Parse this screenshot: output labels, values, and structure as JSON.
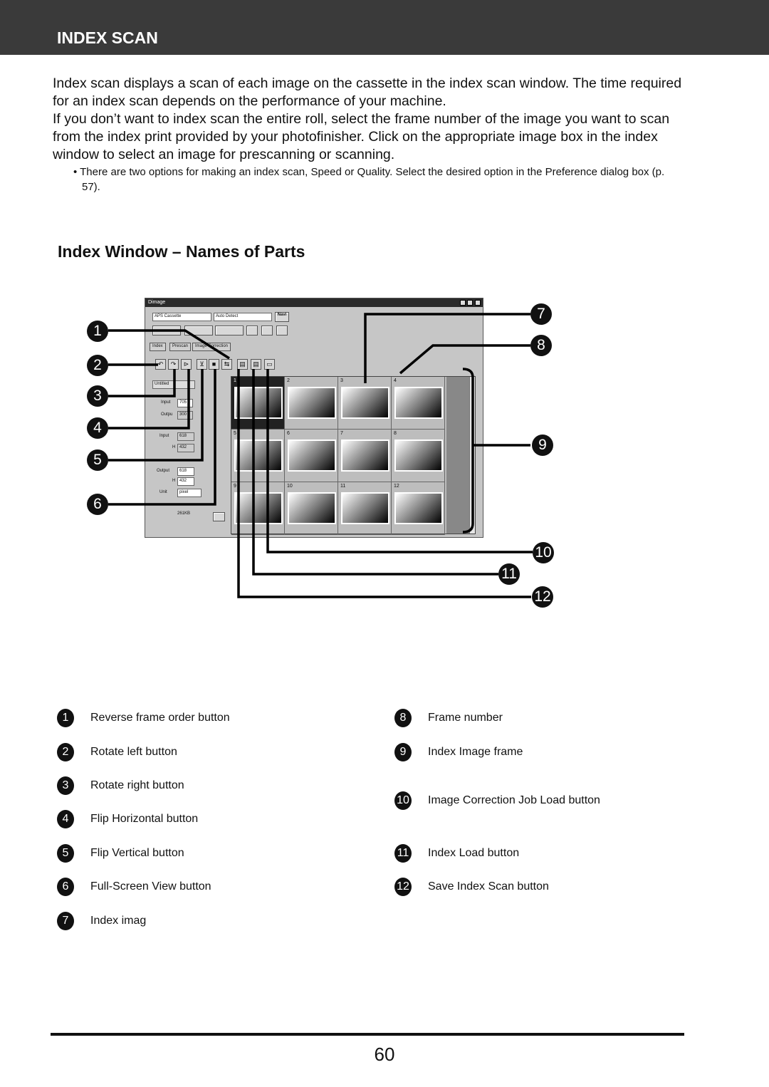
{
  "header": {
    "title": "INDEX SCAN"
  },
  "intro": {
    "p1": "Index scan displays a scan of each image on the cassette in the index scan window. The time required for an index scan depends on the performance of your machine.",
    "p2": "If you don’t want to index scan the entire roll, select the frame number of the image you want to scan from the index print provided by your photofinisher. Click on the appropriate image box in the index window to select an image for prescanning or scanning.",
    "note": "• There are two options for making an index scan, Speed or Quality. Select the desired option in the Preference dialog box (p. 57)."
  },
  "section": {
    "title": "Index Window – Names of Parts"
  },
  "window": {
    "title": "Dimage",
    "film_type": "APS Cassette",
    "detect": "Auto Detect",
    "navi": "Navi",
    "tabs": [
      "Index",
      "Prescan",
      "Image Correction"
    ],
    "untitled": "Untitled",
    "input_label": "Input",
    "input_value": "705",
    "output_label": "Outpu",
    "output_value": "300",
    "input2_label": "Input",
    "input2_w": "618",
    "h_label": "H",
    "input2_h": "432",
    "output2_label": "Output",
    "output2_w": "618",
    "output2_h": "432",
    "unit_label": "Unit",
    "unit_value": "pixel",
    "size": "261KB",
    "frames": [
      "1",
      "2",
      "3",
      "4",
      "5",
      "6",
      "7",
      "8",
      "9",
      "10",
      "11",
      "12"
    ],
    "toolbar_icons": [
      "reverse-frame-order-icon",
      "rotate-left-icon",
      "rotate-right-icon",
      "flip-horizontal-icon",
      "flip-vertical-icon",
      "full-screen-view-icon",
      "image-correction-job-load-icon",
      "index-load-icon",
      "save-index-scan-icon"
    ]
  },
  "callouts": [
    "1",
    "2",
    "3",
    "4",
    "5",
    "6",
    "7",
    "8",
    "9",
    "10",
    "11",
    "12"
  ],
  "legend": [
    {
      "num": "1",
      "label": "Reverse frame order button"
    },
    {
      "num": "2",
      "label": "Rotate left button"
    },
    {
      "num": "3",
      "label": "Rotate right button"
    },
    {
      "num": "4",
      "label": "Flip Horizontal button"
    },
    {
      "num": "5",
      "label": "Flip Vertical button"
    },
    {
      "num": "6",
      "label": "Full-Screen View button"
    },
    {
      "num": "7",
      "label": "Index imag"
    },
    {
      "num": "8",
      "label": "Frame number"
    },
    {
      "num": "9",
      "label": "Index Image frame"
    },
    {
      "num": "10",
      "label": "Image Correction Job Load button"
    },
    {
      "num": "11",
      "label": "Index Load button"
    },
    {
      "num": "12",
      "label": "Save Index Scan button"
    }
  ],
  "page_number": "60"
}
